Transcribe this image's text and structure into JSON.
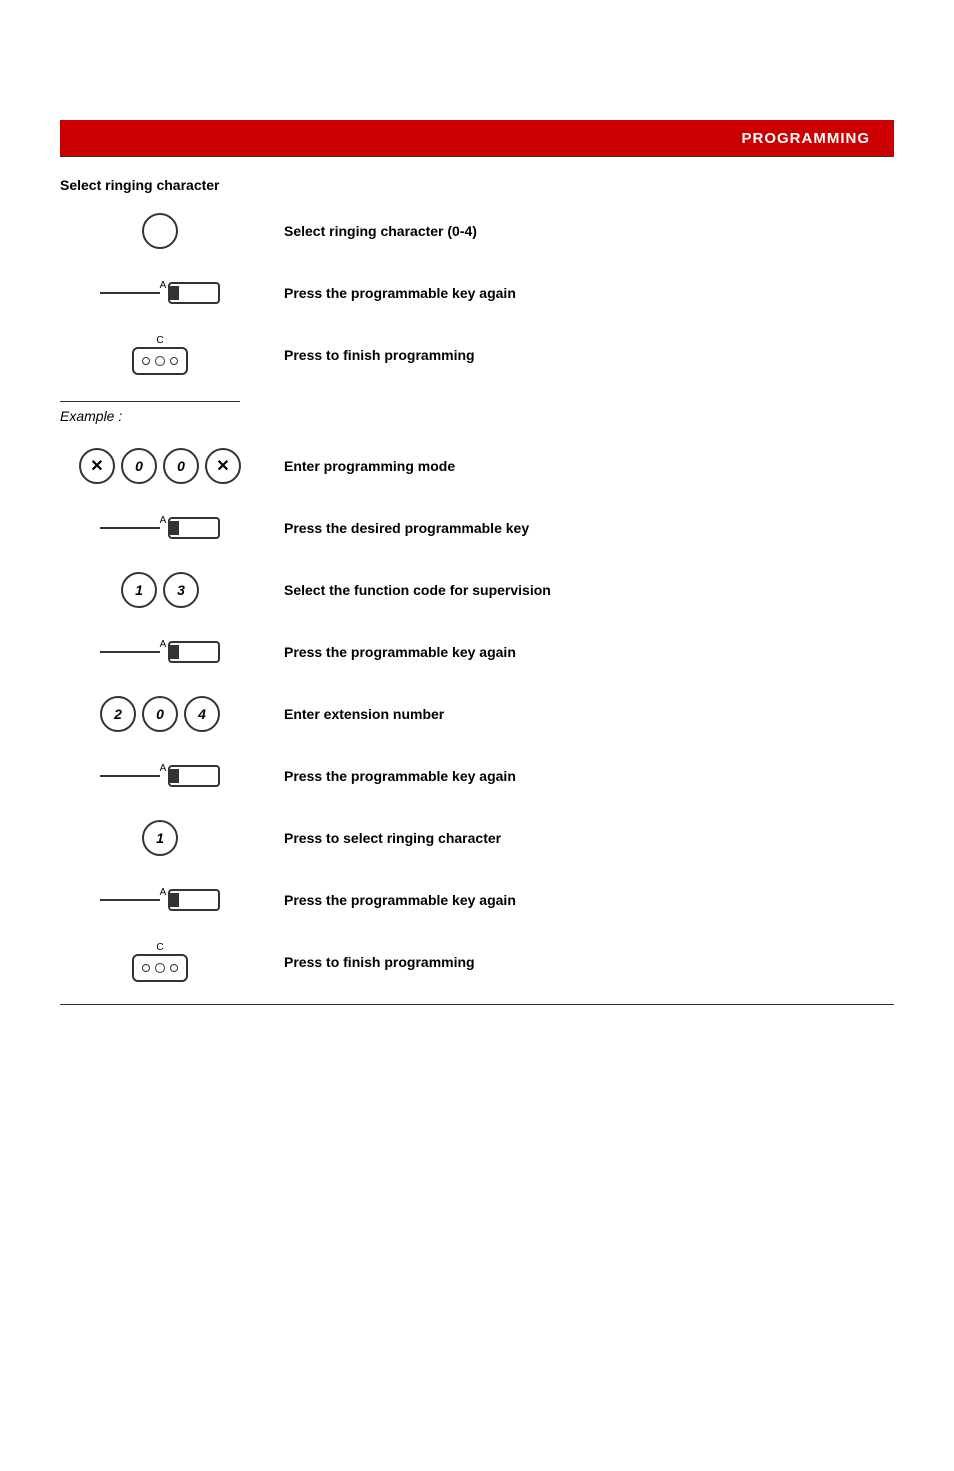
{
  "header": {
    "title": "PROGRAMMING"
  },
  "section1": {
    "title": "Select ringing character",
    "steps": [
      {
        "icon_type": "circle_empty",
        "text": "Select ringing character (0-4)"
      },
      {
        "icon_type": "prog_key",
        "label": "A",
        "text": "Press the programmable key again"
      },
      {
        "icon_type": "c_phone",
        "label": "C",
        "text": "Press to finish programming"
      }
    ]
  },
  "example_label": "Example :",
  "example": {
    "steps": [
      {
        "icon_type": "multi_keys",
        "keys": [
          "✕",
          "0",
          "0",
          "✕"
        ],
        "text": "Enter programming mode"
      },
      {
        "icon_type": "prog_key",
        "label": "A",
        "text": "Press the desired programmable key"
      },
      {
        "icon_type": "two_keys",
        "keys": [
          "1",
          "3"
        ],
        "text": "Select the function code for supervision"
      },
      {
        "icon_type": "prog_key",
        "label": "A",
        "text": "Press the programmable key again"
      },
      {
        "icon_type": "three_keys",
        "keys": [
          "2",
          "0",
          "4"
        ],
        "text": "Enter extension number"
      },
      {
        "icon_type": "prog_key",
        "label": "A",
        "text": "Press the programmable key again"
      },
      {
        "icon_type": "one_key",
        "keys": [
          "1"
        ],
        "text": "Press to select ringing character"
      },
      {
        "icon_type": "prog_key",
        "label": "A",
        "text": "Press the programmable key again"
      },
      {
        "icon_type": "c_phone",
        "label": "C",
        "text": "Press to finish programming"
      }
    ]
  }
}
